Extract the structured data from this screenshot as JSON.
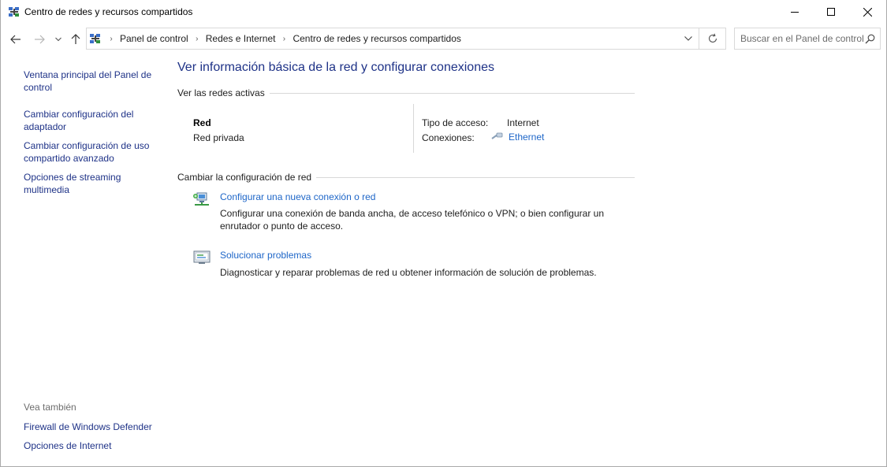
{
  "window": {
    "title": "Centro de redes y recursos compartidos",
    "icon": "network-center-icon"
  },
  "nav": {
    "breadcrumb": [
      "Panel de control",
      "Redes e Internet",
      "Centro de redes y recursos compartidos"
    ],
    "search_placeholder": "Buscar en el Panel de control"
  },
  "sidebar": {
    "links": [
      "Ventana principal del Panel de control",
      "Cambiar configuración del adaptador",
      "Cambiar configuración de uso compartido avanzado",
      "Opciones de streaming multimedia"
    ],
    "see_also_title": "Vea también",
    "see_also_links": [
      "Firewall de Windows Defender",
      "Opciones de Internet"
    ]
  },
  "main": {
    "title": "Ver información básica de la red y configurar conexiones",
    "active_networks_header": "Ver las redes activas",
    "network": {
      "name": "Red",
      "profile": "Red privada",
      "access_type_label": "Tipo de acceso:",
      "access_type_value": "Internet",
      "connections_label": "Conexiones:",
      "connections_value": "Ethernet"
    },
    "change_settings_header": "Cambiar la configuración de red",
    "tasks": [
      {
        "icon": "new-connection-icon",
        "link": "Configurar una nueva conexión o red",
        "description": "Configurar una conexión de banda ancha, de acceso telefónico o VPN; o bien configurar un enrutador o punto de acceso."
      },
      {
        "icon": "troubleshoot-icon",
        "link": "Solucionar problemas",
        "description": "Diagnosticar y reparar problemas de red u obtener información de solución de problemas."
      }
    ]
  },
  "colors": {
    "link_dark": "#1e3287",
    "link_blue": "#1e66c8",
    "divider": "#d8d8d8"
  }
}
